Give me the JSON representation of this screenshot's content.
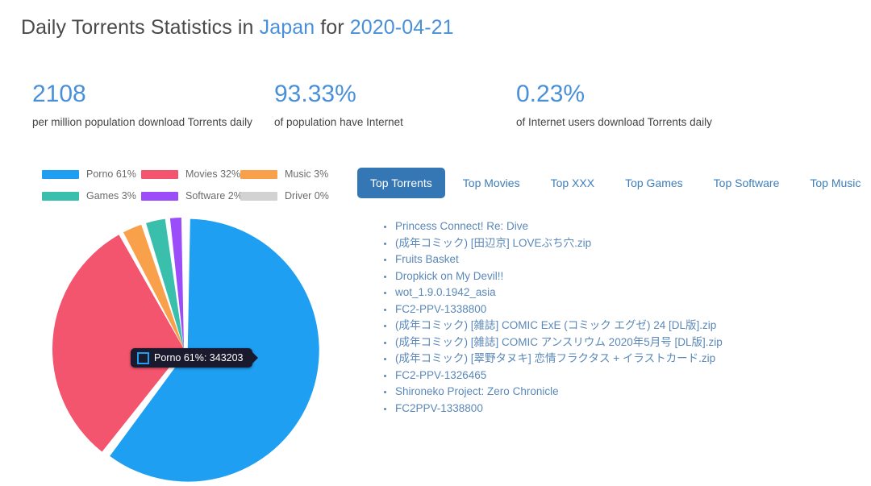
{
  "header": {
    "title_prefix": "Daily Torrents Statistics in ",
    "country": "Japan",
    "title_middle": " for ",
    "date": "2020-04-21"
  },
  "stats": [
    {
      "value": "2108",
      "label": "per million population download Torrents daily"
    },
    {
      "value": "93.33%",
      "label": "of population have Internet"
    },
    {
      "value": "0.23%",
      "label": "of Internet users download Torrents daily"
    }
  ],
  "chart_data": {
    "type": "pie",
    "title": "",
    "legend_position": "top",
    "categories": [
      "Porno",
      "Movies",
      "Music",
      "Games",
      "Software",
      "Driver"
    ],
    "values": [
      61,
      32,
      3,
      3,
      2,
      0
    ],
    "legend_labels": [
      "Porno 61%",
      "Movies 32%",
      "Music 3%",
      "Games 3%",
      "Software 2%",
      "Driver 0%"
    ],
    "colors": [
      "#1e9ff2",
      "#f4556e",
      "#f9a14a",
      "#3bbfad",
      "#9c4dfa",
      "#d2d2d2"
    ],
    "tooltip": {
      "label": "Porno 61%: 343203",
      "series": "Porno",
      "percent": 61,
      "value": 343203,
      "marker_color": "#1e9ff2"
    }
  },
  "tabs": [
    {
      "label": "Top Torrents",
      "active": true
    },
    {
      "label": "Top Movies",
      "active": false
    },
    {
      "label": "Top XXX",
      "active": false
    },
    {
      "label": "Top Games",
      "active": false
    },
    {
      "label": "Top Software",
      "active": false
    },
    {
      "label": "Top Music",
      "active": false
    }
  ],
  "torrents": [
    "Princess Connect! Re: Dive",
    "(成年コミック) [田辺京] LOVEぶち穴.zip",
    "Fruits Basket",
    "Dropkick on My Devil!!",
    "wot_1.9.0.1942_asia",
    "FC2-PPV-1338800",
    "(成年コミック) [雑誌] COMIC ExE (コミック エグゼ) 24 [DL版].zip",
    "(成年コミック) [雑誌] COMIC アンスリウム 2020年5月号 [DL版].zip",
    "(成年コミック) [翠野タヌキ] 恋情フラクタス + イラストカード.zip",
    "FC2-PPV-1326465",
    "Shironeko Project: Zero Chronicle",
    "FC2PPV-1338800"
  ]
}
